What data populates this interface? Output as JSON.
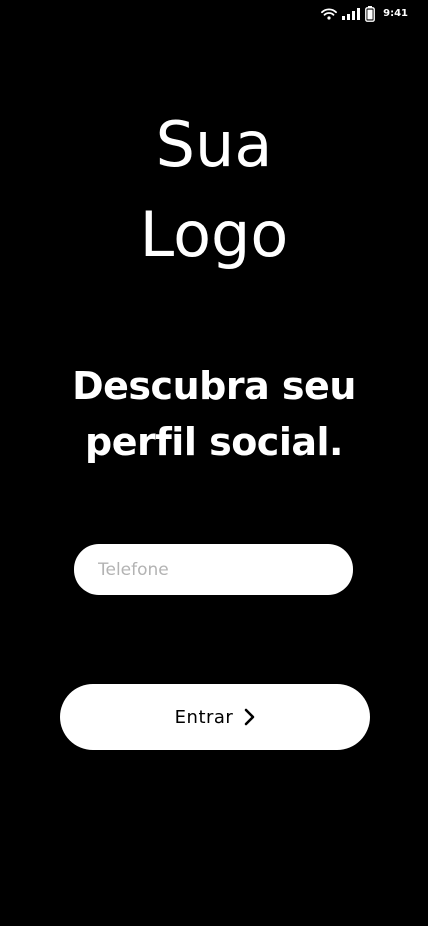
{
  "status_bar": {
    "time": "9:41",
    "icons": [
      "wifi-icon",
      "signal-icon",
      "battery-icon"
    ]
  },
  "logo": {
    "line1": "Sua",
    "line2": "Logo"
  },
  "headline": {
    "line1": "Descubra seu",
    "line2": "perfil social."
  },
  "phone_input": {
    "placeholder": "Telefone",
    "value": ""
  },
  "enter_button": {
    "label": "Entrar",
    "icon": "chevron-right-icon"
  },
  "colors": {
    "background": "#000000",
    "foreground": "#ffffff",
    "placeholder": "#b3b3b3"
  }
}
